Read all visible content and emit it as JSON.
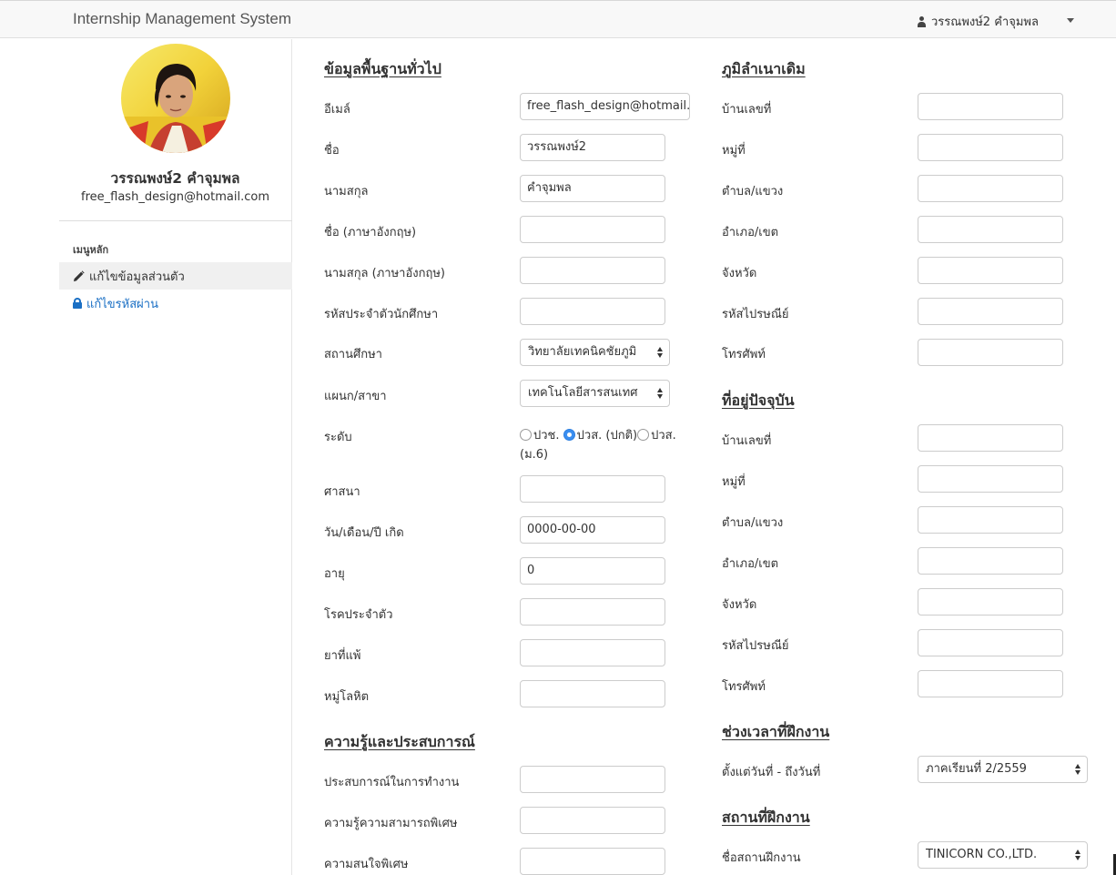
{
  "app": {
    "title": "Internship Management System"
  },
  "user": {
    "display_name": "วรรณพงษ์2 คำจุมพล"
  },
  "profile": {
    "name": "วรรณพงษ์2 คำจุมพล",
    "email": "free_flash_design@hotmail.com"
  },
  "sidebar": {
    "heading": "เมนูหลัก",
    "items": [
      {
        "label": "แก้ไขข้อมูลส่วนตัว",
        "icon": "pencil-icon",
        "active": true
      },
      {
        "label": "แก้ไขรหัสผ่าน",
        "icon": "lock-icon",
        "active": false
      }
    ]
  },
  "general": {
    "title": "ข้อมูลพื้นฐานทั่วไป",
    "email": {
      "label": "อีเมล์",
      "value": "free_flash_design@hotmail.com"
    },
    "first_name": {
      "label": "ชื่อ",
      "value": "วรรณพงษ์2"
    },
    "last_name": {
      "label": "นามสกุล",
      "value": "คำจุมพล"
    },
    "first_name_en": {
      "label": "ชื่อ (ภาษาอังกฤษ)",
      "value": ""
    },
    "last_name_en": {
      "label": "นามสกุล (ภาษาอังกฤษ)",
      "value": ""
    },
    "student_id": {
      "label": "รหัสประจำตัวนักศึกษา",
      "value": ""
    },
    "institution": {
      "label": "สถานศึกษา",
      "value": "วิทยาลัยเทคนิคชัยภูมิ"
    },
    "department": {
      "label": "แผนก/สาขา",
      "value": "เทคโนโลยีสารสนเทศ"
    },
    "level": {
      "label": "ระดับ",
      "options": [
        "ปวช.",
        "ปวส. (ปกติ)",
        "ปวส.",
        "(ม.6)"
      ],
      "selected": "ปวส. (ปกติ)"
    },
    "religion": {
      "label": "ศาสนา",
      "value": ""
    },
    "birth_date": {
      "label": "วัน/เดือน/ปี เกิด",
      "value": "0000-00-00"
    },
    "age": {
      "label": "อายุ",
      "value": "0"
    },
    "disease": {
      "label": "โรคประจำตัว",
      "value": ""
    },
    "allergy": {
      "label": "ยาที่แพ้",
      "value": ""
    },
    "blood_type": {
      "label": "หมู่โลหิต",
      "value": ""
    }
  },
  "knowledge": {
    "title": "ความรู้และประสบการณ์",
    "experience": {
      "label": "ประสบการณ์ในการทำงาน",
      "value": ""
    },
    "skills": {
      "label": "ความรู้ความสามารถพิเศษ",
      "value": ""
    },
    "interests": {
      "label": "ความสนใจพิเศษ",
      "value": ""
    }
  },
  "hometown": {
    "title": "ภูมิลำเนาเดิม",
    "house_no": {
      "label": "บ้านเลขที่",
      "value": ""
    },
    "moo": {
      "label": "หมู่ที่",
      "value": ""
    },
    "subdistrict": {
      "label": "ตำบล/แขวง",
      "value": ""
    },
    "district": {
      "label": "อำเภอ/เขต",
      "value": ""
    },
    "province": {
      "label": "จังหวัด",
      "value": ""
    },
    "postal_code": {
      "label": "รหัสไปรษณีย์",
      "value": ""
    },
    "phone": {
      "label": "โทรศัพท์",
      "value": ""
    }
  },
  "current_address": {
    "title": "ที่อยู่ปัจจุบัน",
    "house_no": {
      "label": "บ้านเลขที่",
      "value": ""
    },
    "moo": {
      "label": "หมู่ที่",
      "value": ""
    },
    "subdistrict": {
      "label": "ตำบล/แขวง",
      "value": ""
    },
    "district": {
      "label": "อำเภอ/เขต",
      "value": ""
    },
    "province": {
      "label": "จังหวัด",
      "value": ""
    },
    "postal_code": {
      "label": "รหัสไปรษณีย์",
      "value": ""
    },
    "phone": {
      "label": "โทรศัพท์",
      "value": ""
    }
  },
  "period": {
    "title": "ช่วงเวลาที่ฝึกงาน",
    "range": {
      "label": "ตั้งแต่วันที่ - ถึงวันที่",
      "value": "ภาคเรียนที่ 2/2559"
    }
  },
  "workplace": {
    "title": "สถานที่ฝึกงาน",
    "name": {
      "label": "ชื่อสถานฝึกงาน",
      "value": "TINICORN CO.,LTD."
    }
  }
}
